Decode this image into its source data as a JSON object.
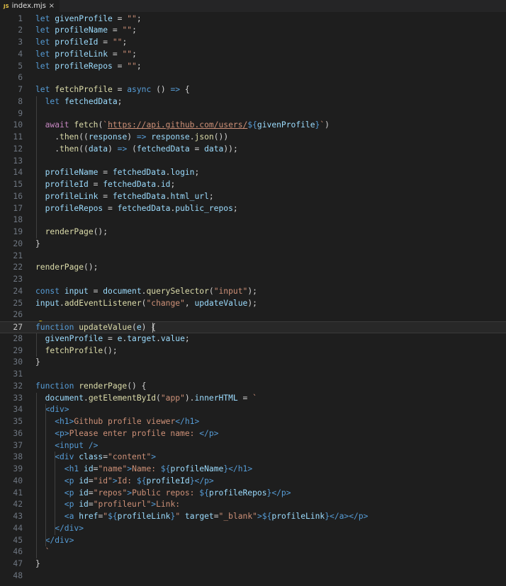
{
  "tab": {
    "badge": "JS",
    "filename": "index.mjs",
    "close": "×"
  },
  "editor": {
    "current_line": 27,
    "lines": [
      [
        [
          "let ",
          "kw"
        ],
        [
          "givenProfile",
          "var"
        ],
        [
          " = ",
          "pun"
        ],
        [
          "\"\"",
          "str"
        ],
        [
          ";",
          "pun"
        ]
      ],
      [
        [
          "let ",
          "kw"
        ],
        [
          "profileName",
          "var"
        ],
        [
          " = ",
          "pun"
        ],
        [
          "\"\"",
          "str"
        ],
        [
          ";",
          "pun"
        ]
      ],
      [
        [
          "let ",
          "kw"
        ],
        [
          "profileId",
          "var"
        ],
        [
          " = ",
          "pun"
        ],
        [
          "\"\"",
          "str"
        ],
        [
          ";",
          "pun"
        ]
      ],
      [
        [
          "let ",
          "kw"
        ],
        [
          "profileLink",
          "var"
        ],
        [
          " = ",
          "pun"
        ],
        [
          "\"\"",
          "str"
        ],
        [
          ";",
          "pun"
        ]
      ],
      [
        [
          "let ",
          "kw"
        ],
        [
          "profileRepos",
          "var"
        ],
        [
          " = ",
          "pun"
        ],
        [
          "\"\"",
          "str"
        ],
        [
          ";",
          "pun"
        ]
      ],
      [],
      [
        [
          "let ",
          "kw"
        ],
        [
          "fetchProfile",
          "fn"
        ],
        [
          " = ",
          "pun"
        ],
        [
          "async",
          "kw"
        ],
        [
          " () ",
          "pun"
        ],
        [
          "=>",
          "kw"
        ],
        [
          " {",
          "pun"
        ]
      ],
      [
        [
          "  let ",
          "kw"
        ],
        [
          "fetchedData",
          "var"
        ],
        [
          ";",
          "pun"
        ]
      ],
      [],
      [
        [
          "  await ",
          "ctl"
        ],
        [
          "fetch",
          "fn"
        ],
        [
          "(",
          "pun"
        ],
        [
          "`",
          "str"
        ],
        [
          "https://api.github.com/users/",
          "url"
        ],
        [
          "${",
          "kw"
        ],
        [
          "givenProfile",
          "var"
        ],
        [
          "}",
          "kw"
        ],
        [
          "`",
          "str"
        ],
        [
          ")",
          "pun"
        ]
      ],
      [
        [
          "    .",
          "pun"
        ],
        [
          "then",
          "fn"
        ],
        [
          "((",
          "pun"
        ],
        [
          "response",
          "var"
        ],
        [
          ") ",
          "pun"
        ],
        [
          "=>",
          "kw"
        ],
        [
          " ",
          "pun"
        ],
        [
          "response",
          "var"
        ],
        [
          ".",
          "pun"
        ],
        [
          "json",
          "fn"
        ],
        [
          "())",
          "pun"
        ]
      ],
      [
        [
          "    .",
          "pun"
        ],
        [
          "then",
          "fn"
        ],
        [
          "((",
          "pun"
        ],
        [
          "data",
          "var"
        ],
        [
          ") ",
          "pun"
        ],
        [
          "=>",
          "kw"
        ],
        [
          " (",
          "pun"
        ],
        [
          "fetchedData",
          "var"
        ],
        [
          " = ",
          "pun"
        ],
        [
          "data",
          "var"
        ],
        [
          "));",
          "pun"
        ]
      ],
      [],
      [
        [
          "  profileName",
          "var"
        ],
        [
          " = ",
          "pun"
        ],
        [
          "fetchedData",
          "var"
        ],
        [
          ".",
          "pun"
        ],
        [
          "login",
          "var"
        ],
        [
          ";",
          "pun"
        ]
      ],
      [
        [
          "  profileId",
          "var"
        ],
        [
          " = ",
          "pun"
        ],
        [
          "fetchedData",
          "var"
        ],
        [
          ".",
          "pun"
        ],
        [
          "id",
          "var"
        ],
        [
          ";",
          "pun"
        ]
      ],
      [
        [
          "  profileLink",
          "var"
        ],
        [
          " = ",
          "pun"
        ],
        [
          "fetchedData",
          "var"
        ],
        [
          ".",
          "pun"
        ],
        [
          "html_url",
          "var"
        ],
        [
          ";",
          "pun"
        ]
      ],
      [
        [
          "  profileRepos",
          "var"
        ],
        [
          " = ",
          "pun"
        ],
        [
          "fetchedData",
          "var"
        ],
        [
          ".",
          "pun"
        ],
        [
          "public_repos",
          "var"
        ],
        [
          ";",
          "pun"
        ]
      ],
      [],
      [
        [
          "  renderPage",
          "fn"
        ],
        [
          "();",
          "pun"
        ]
      ],
      [
        [
          "}",
          "pun"
        ]
      ],
      [],
      [
        [
          "renderPage",
          "fn"
        ],
        [
          "();",
          "pun"
        ]
      ],
      [],
      [
        [
          "const ",
          "kw"
        ],
        [
          "input",
          "var"
        ],
        [
          " = ",
          "pun"
        ],
        [
          "document",
          "var"
        ],
        [
          ".",
          "pun"
        ],
        [
          "querySelector",
          "fn"
        ],
        [
          "(",
          "pun"
        ],
        [
          "\"input\"",
          "str"
        ],
        [
          ");",
          "pun"
        ]
      ],
      [
        [
          "input",
          "var"
        ],
        [
          ".",
          "pun"
        ],
        [
          "addEventListener",
          "fn"
        ],
        [
          "(",
          "pun"
        ],
        [
          "\"change\"",
          "str"
        ],
        [
          ", ",
          "pun"
        ],
        [
          "updateValue",
          "var"
        ],
        [
          ");",
          "pun"
        ]
      ],
      [],
      [
        [
          "function ",
          "kw"
        ],
        [
          "updateValue",
          "fn"
        ],
        [
          "(",
          "pun"
        ],
        [
          "e",
          "var"
        ],
        [
          ") {",
          "pun"
        ]
      ],
      [
        [
          "  givenProfile",
          "var"
        ],
        [
          " = ",
          "pun"
        ],
        [
          "e",
          "var"
        ],
        [
          ".",
          "pun"
        ],
        [
          "target",
          "var"
        ],
        [
          ".",
          "pun"
        ],
        [
          "value",
          "var"
        ],
        [
          ";",
          "pun"
        ]
      ],
      [
        [
          "  fetchProfile",
          "fn"
        ],
        [
          "();",
          "pun"
        ]
      ],
      [
        [
          "}",
          "pun"
        ]
      ],
      [],
      [
        [
          "function ",
          "kw"
        ],
        [
          "renderPage",
          "fn"
        ],
        [
          "() {",
          "pun"
        ]
      ],
      [
        [
          "  document",
          "var"
        ],
        [
          ".",
          "pun"
        ],
        [
          "getElementById",
          "fn"
        ],
        [
          "(",
          "pun"
        ],
        [
          "\"app\"",
          "str"
        ],
        [
          ").",
          "pun"
        ],
        [
          "innerHTML",
          "var"
        ],
        [
          " = ",
          "pun"
        ],
        [
          "`",
          "str"
        ]
      ],
      [
        [
          "  <div>",
          "tag"
        ]
      ],
      [
        [
          "    <h1>",
          "tag"
        ],
        [
          "Github profile viewer",
          "tmpl"
        ],
        [
          "</h1>",
          "tag"
        ]
      ],
      [
        [
          "    <p>",
          "tag"
        ],
        [
          "Please enter profile name: ",
          "tmpl"
        ],
        [
          "</p>",
          "tag"
        ]
      ],
      [
        [
          "    <input />",
          "tag"
        ]
      ],
      [
        [
          "    <div ",
          "tag"
        ],
        [
          "class",
          "attr"
        ],
        [
          "=",
          "pun"
        ],
        [
          "\"content\"",
          "str"
        ],
        [
          ">",
          "tag"
        ]
      ],
      [
        [
          "      <h1 ",
          "tag"
        ],
        [
          "id",
          "attr"
        ],
        [
          "=",
          "pun"
        ],
        [
          "\"name\"",
          "str"
        ],
        [
          ">",
          "tag"
        ],
        [
          "Name: ",
          "tmpl"
        ],
        [
          "${",
          "kw"
        ],
        [
          "profileName",
          "var"
        ],
        [
          "}",
          "kw"
        ],
        [
          "</h1>",
          "tag"
        ]
      ],
      [
        [
          "      <p ",
          "tag"
        ],
        [
          "id",
          "attr"
        ],
        [
          "=",
          "pun"
        ],
        [
          "\"id\"",
          "str"
        ],
        [
          ">",
          "tag"
        ],
        [
          "Id: ",
          "tmpl"
        ],
        [
          "${",
          "kw"
        ],
        [
          "profileId",
          "var"
        ],
        [
          "}",
          "kw"
        ],
        [
          "</p>",
          "tag"
        ]
      ],
      [
        [
          "      <p ",
          "tag"
        ],
        [
          "id",
          "attr"
        ],
        [
          "=",
          "pun"
        ],
        [
          "\"repos\"",
          "str"
        ],
        [
          ">",
          "tag"
        ],
        [
          "Public repos: ",
          "tmpl"
        ],
        [
          "${",
          "kw"
        ],
        [
          "profileRepos",
          "var"
        ],
        [
          "}",
          "kw"
        ],
        [
          "</p>",
          "tag"
        ]
      ],
      [
        [
          "      <p ",
          "tag"
        ],
        [
          "id",
          "attr"
        ],
        [
          "=",
          "pun"
        ],
        [
          "\"profileurl\"",
          "str"
        ],
        [
          ">",
          "tag"
        ],
        [
          "Link:",
          "tmpl"
        ]
      ],
      [
        [
          "      <a ",
          "tag"
        ],
        [
          "href",
          "attr"
        ],
        [
          "=",
          "pun"
        ],
        [
          "\"",
          "str"
        ],
        [
          "${",
          "kw"
        ],
        [
          "profileLink",
          "var"
        ],
        [
          "}",
          "kw"
        ],
        [
          "\"",
          "str"
        ],
        [
          " target",
          "attr"
        ],
        [
          "=",
          "pun"
        ],
        [
          "\"_blank\"",
          "str"
        ],
        [
          ">",
          "tag"
        ],
        [
          "${",
          "kw"
        ],
        [
          "profileLink",
          "var"
        ],
        [
          "}",
          "kw"
        ],
        [
          "</a></p>",
          "tag"
        ]
      ],
      [
        [
          "    </div>",
          "tag"
        ]
      ],
      [
        [
          "  </div>",
          "tag"
        ]
      ],
      [
        [
          "  `",
          "str"
        ]
      ],
      [
        [
          "}",
          "pun"
        ]
      ],
      []
    ]
  }
}
